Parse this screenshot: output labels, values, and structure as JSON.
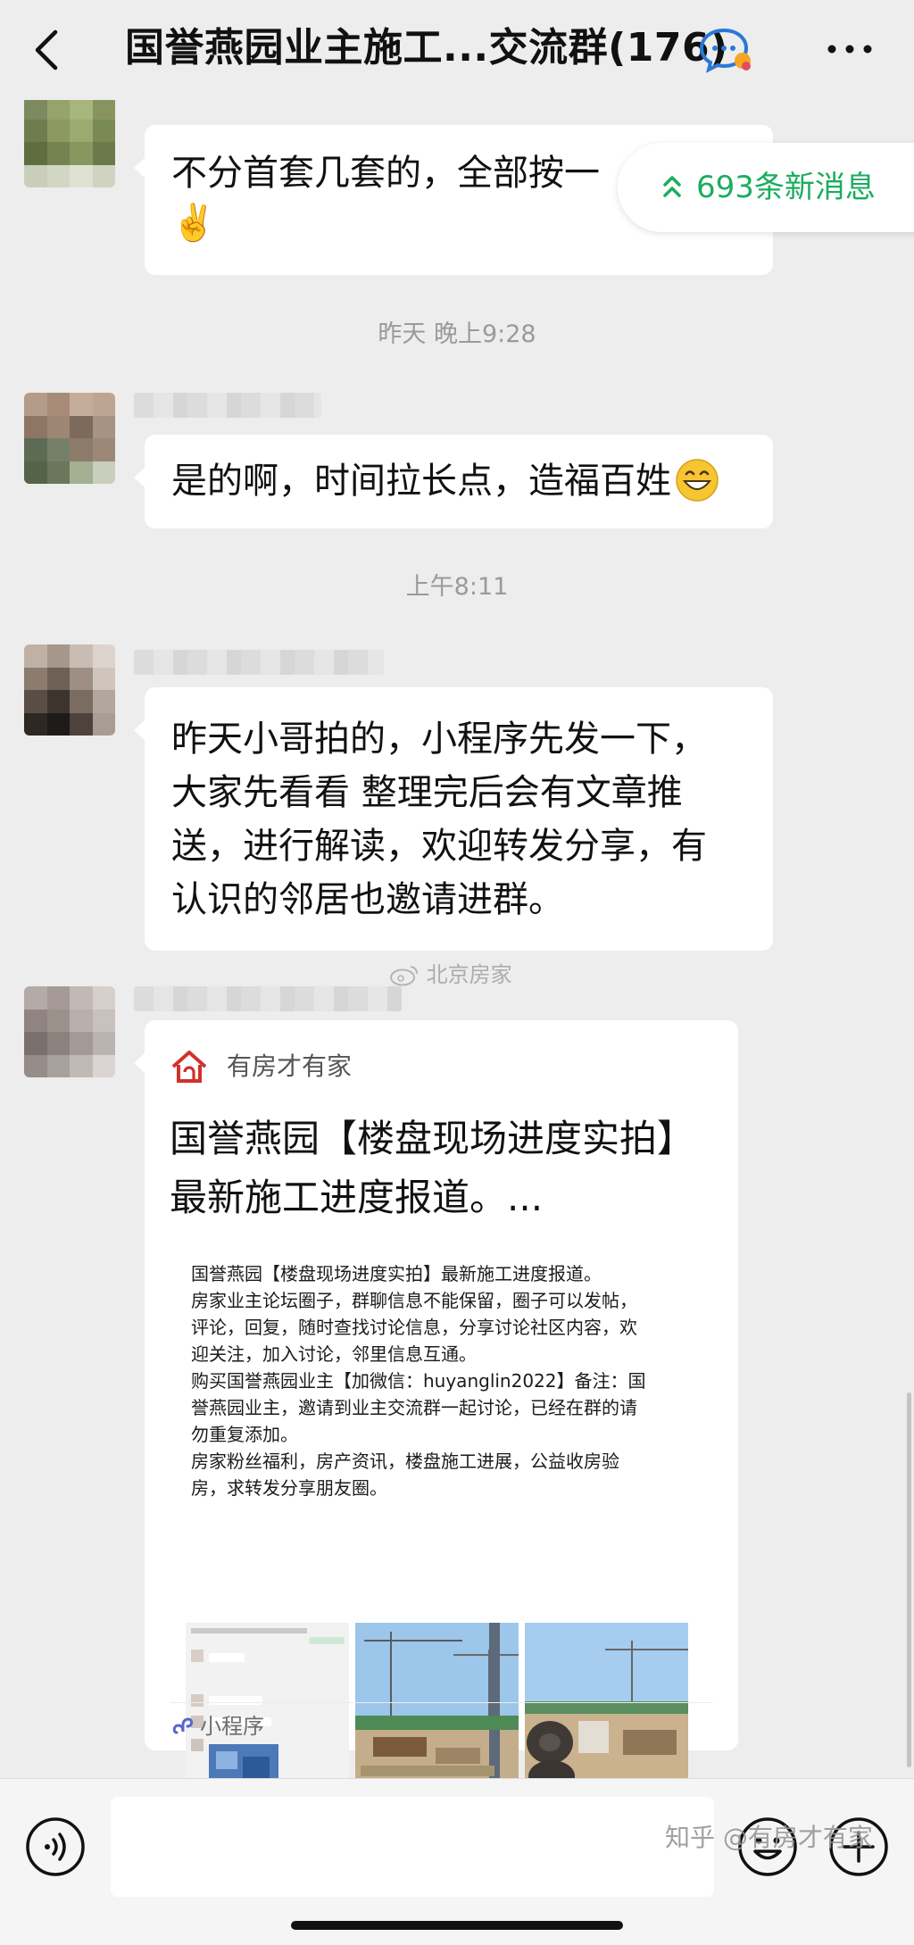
{
  "header": {
    "title": "国誉燕园业主施工...交流群(176)"
  },
  "banner": {
    "new_messages": "693条新消息"
  },
  "messages": [
    {
      "text": "不分首套几套的，全部按一",
      "emoji": "✌️"
    },
    {
      "text": "是的啊，时间拉长点，造福百姓"
    },
    {
      "lines": [
        "昨天小哥拍的，小程序先发一下，",
        "大家先看看 整理完后会有文章推",
        "送，进行解读，欢迎转发分享，有",
        "认识的邻居也邀请进群。"
      ]
    }
  ],
  "timestamps": {
    "yesterday": "昨天 晚上9:28",
    "morning": "上午8:11"
  },
  "card": {
    "brand": "有房才有家",
    "title_lines": [
      "国誉燕园【楼盘现场进度实拍】",
      "最新施工进度报道。..."
    ],
    "preview_lines": [
      "国誉燕园【楼盘现场进度实拍】最新施工进度报道。",
      "房家业主论坛圈子，群聊信息不能保留，圈子可以发帖，",
      "评论，回复，随时查找讨论信息，分享讨论社区内容，欢",
      "迎关注，加入讨论，邻里信息互通。",
      "购买国誉燕园业主【加微信：huyanglin2022】备注：国",
      "誉燕园业主，邀请到业主交流群一起讨论，已经在群的请",
      "勿重复添加。",
      "房家粉丝福利，房产资讯，楼盘施工进展，公益收房验",
      "房，求转发分享朋友圈。"
    ],
    "footer": "小程序"
  },
  "watermarks": {
    "mid": "北京房家",
    "bottom": "知乎 @有房才有家"
  },
  "colors": {
    "accent_green": "#1aad5f",
    "background": "#ededed"
  }
}
